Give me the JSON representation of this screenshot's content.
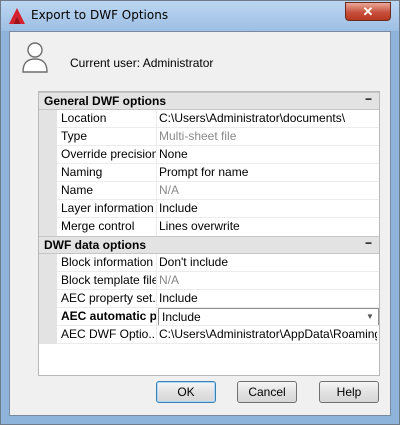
{
  "window": {
    "title": "Export to DWF Options"
  },
  "header": {
    "current_user": "Current user: Administrator"
  },
  "general": {
    "title": "General DWF options",
    "collapse_glyph": "−",
    "rows": [
      {
        "name": "Location",
        "value": "C:\\Users\\Administrator\\documents\\",
        "readonly": false
      },
      {
        "name": "Type",
        "value": "Multi-sheet file",
        "readonly": true
      },
      {
        "name": "Override precision",
        "value": "None",
        "readonly": false
      },
      {
        "name": "Naming",
        "value": "Prompt for name",
        "readonly": false
      },
      {
        "name": "Name",
        "value": "N/A",
        "readonly": true
      },
      {
        "name": "Layer information",
        "value": "Include",
        "readonly": false
      },
      {
        "name": "Merge control",
        "value": "Lines overwrite",
        "readonly": false
      }
    ]
  },
  "data_options": {
    "title": "DWF data options",
    "collapse_glyph": "−",
    "rows": [
      {
        "name": "Block information",
        "value": "Don't include",
        "readonly": false
      },
      {
        "name": "Block template file",
        "value": "N/A",
        "readonly": true
      },
      {
        "name": "AEC property set...",
        "value": "Include",
        "readonly": false
      },
      {
        "name": "AEC automatic p...",
        "value": "Include",
        "readonly": false,
        "selected": true
      },
      {
        "name": "AEC DWF Optio...",
        "value": "C:\\Users\\Administrator\\AppData\\Roaming\\A...",
        "readonly": false
      }
    ]
  },
  "buttons": {
    "ok": "OK",
    "cancel": "Cancel",
    "help": "Help"
  },
  "icons": {
    "app": "autocad-logo-icon",
    "user": "user-icon",
    "close": "close-icon",
    "dropdown": "chevron-down-icon"
  },
  "colors": {
    "title_bar": "#9dbfe4",
    "close_button": "#c7503c",
    "category_bg": "#e3e3e3",
    "autocad_red": "#d6202e"
  }
}
